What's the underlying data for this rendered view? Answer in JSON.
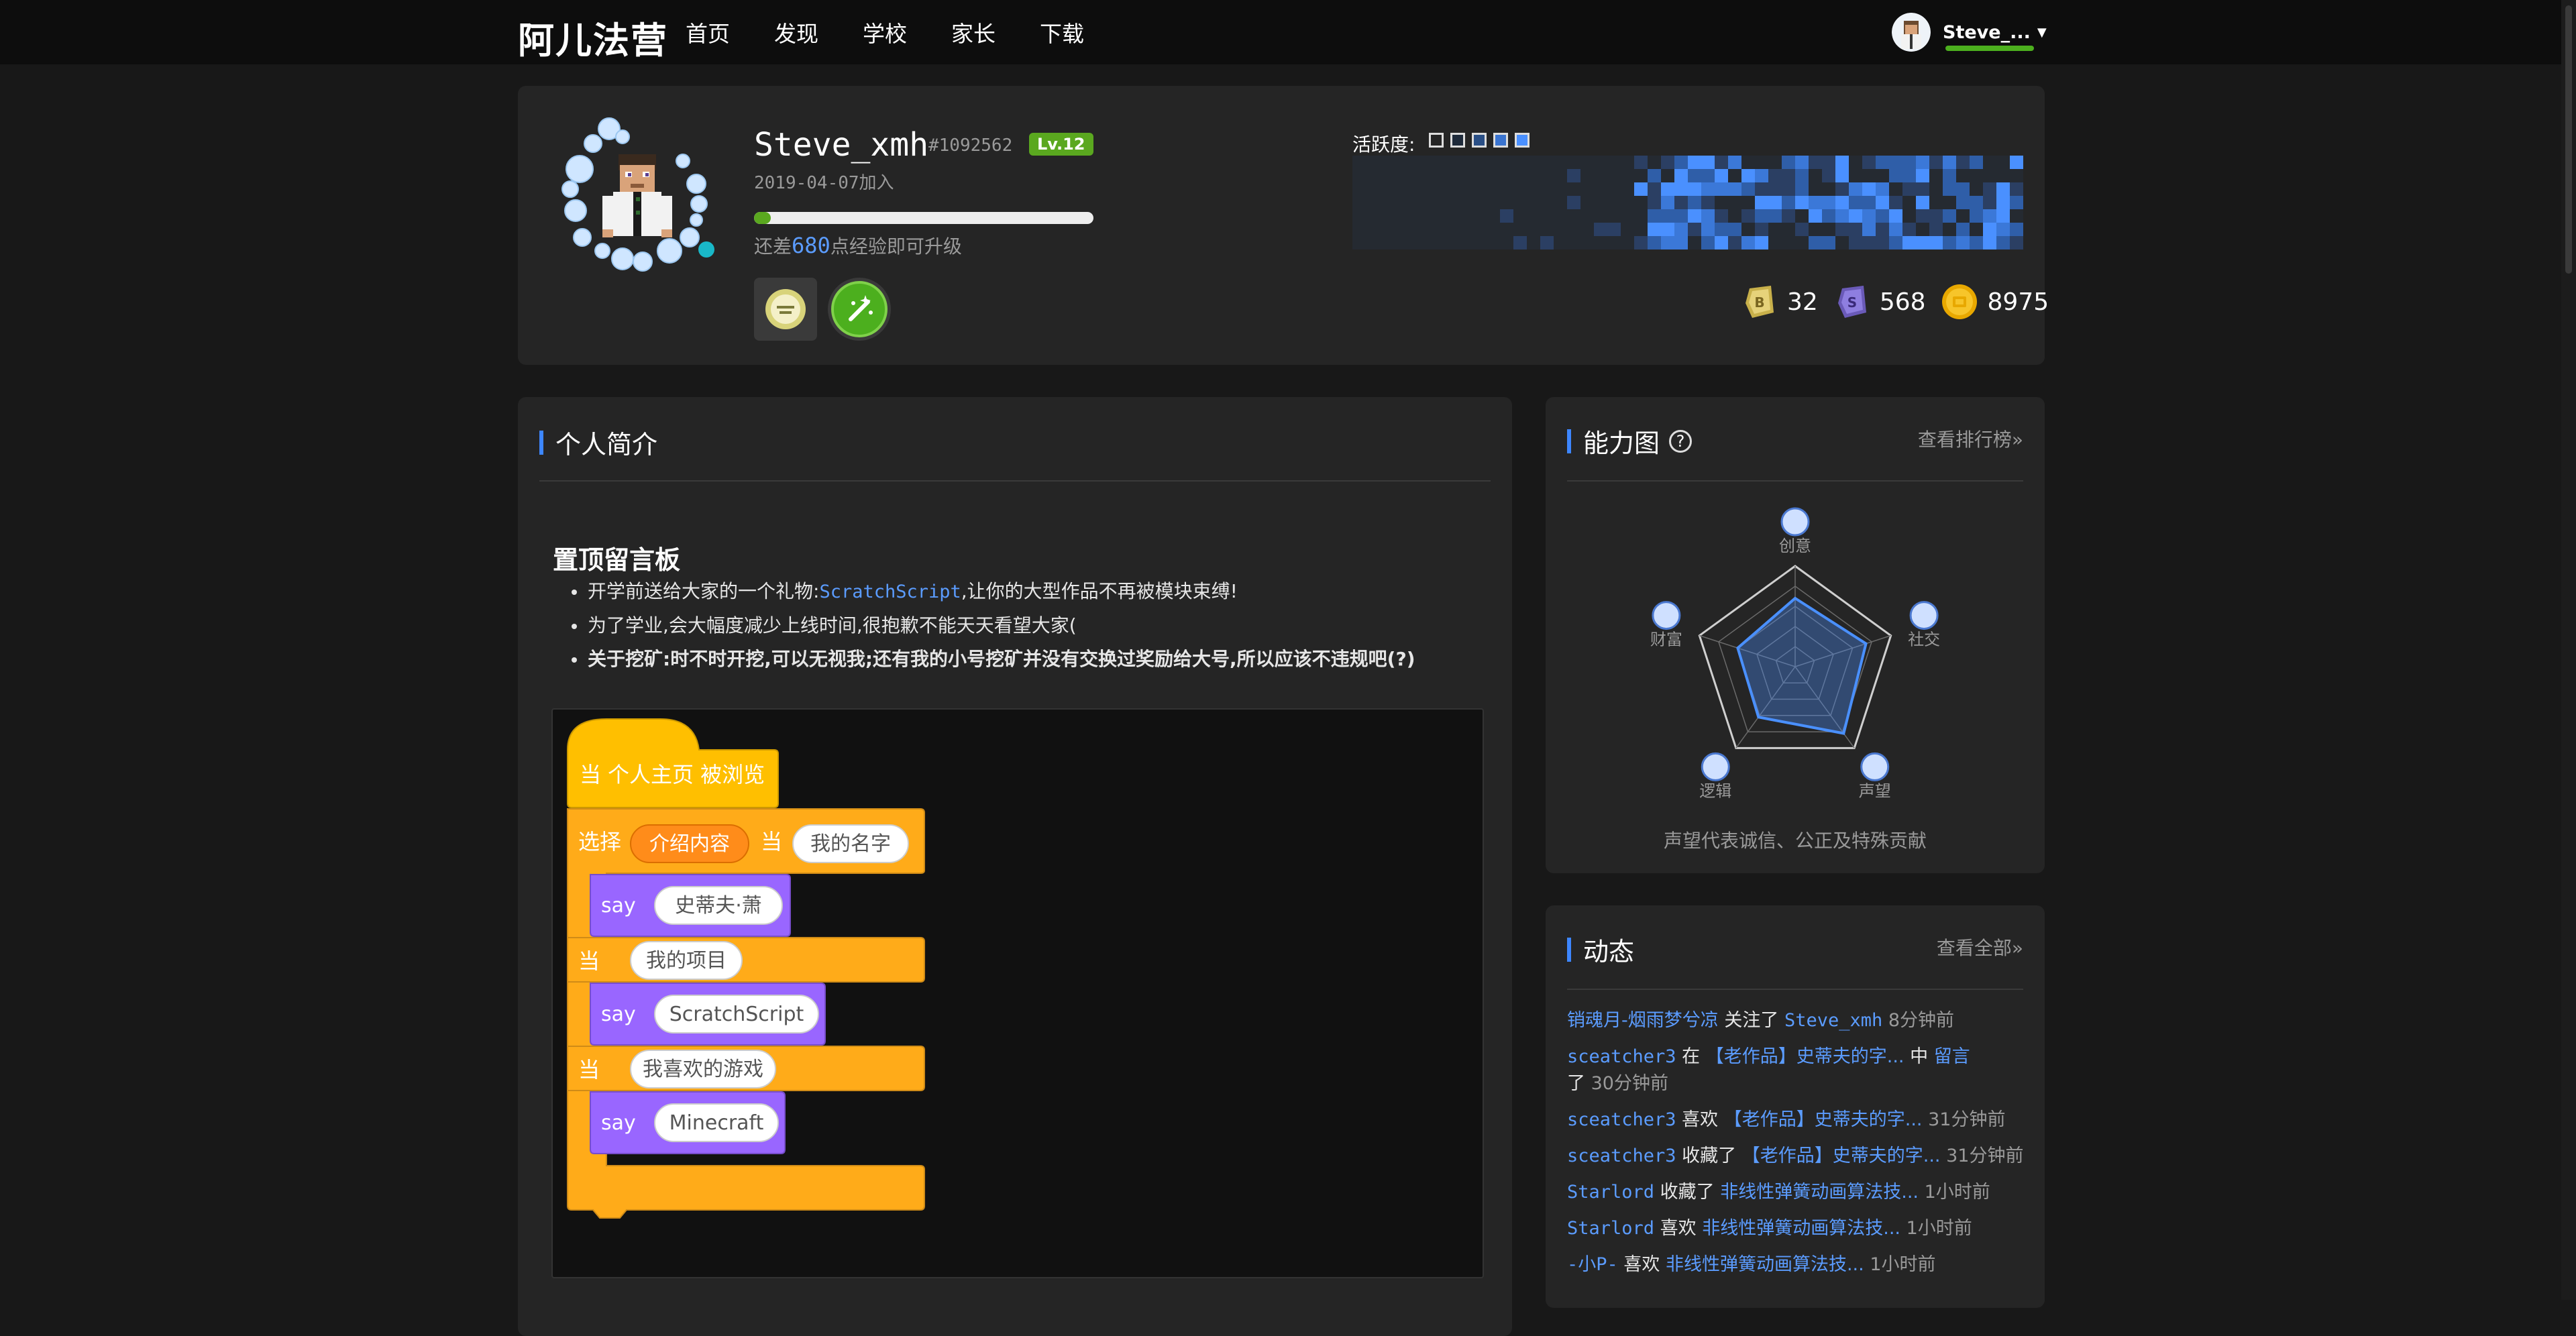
{
  "logo": "阿儿法营",
  "nav": [
    "首页",
    "发现",
    "学校",
    "家长",
    "下载"
  ],
  "user": {
    "name": "Steve_..."
  },
  "profile": {
    "name": "Steve_xmh",
    "id": "#1092562",
    "level": "Lv.12",
    "joined": "2019-04-07加入",
    "xp_progress": 0.05,
    "xp_prefix": "还差",
    "xp_needed": "680",
    "xp_suffix": "点经验即可升级",
    "activity_label": "活跃度:",
    "currency": [
      {
        "icon": "bronze-gem-icon",
        "value": "32"
      },
      {
        "icon": "purple-gem-icon",
        "value": "568"
      },
      {
        "icon": "gold-coin-icon",
        "value": "8975"
      }
    ]
  },
  "intro": {
    "title": "个人简介",
    "pinned_title": "置顶留言板",
    "bullet1_prefix": "开学前送给大家的一个礼物:",
    "bullet1_code": "ScratchScript",
    "bullet1_suffix": ",让你的大型作品不再被模块束缚!",
    "bullet2": "为了学业,会大幅度减少上线时间,很抱歉不能天天看望大家(",
    "bullet3": "关于挖矿:时不时开挖,可以无视我;还有我的小号挖矿并没有交换过奖励给大号,所以应该不违规吧(?)"
  },
  "scratch": {
    "hat_when": "当",
    "hat_text": "个人主页 被浏览",
    "switch": "选择",
    "switch_var": "介绍内容",
    "when": "当",
    "case1": "我的名字",
    "say": "say",
    "say1": "史蒂夫·萧",
    "case2": "我的项目",
    "say2": "ScratchScript",
    "case3": "我喜欢的游戏",
    "say3": "Minecraft"
  },
  "ability": {
    "title": "能力图",
    "more": "查看排行榜»",
    "axes": [
      "创意",
      "社交",
      "声望",
      "逻辑",
      "财富"
    ],
    "note": "声望代表诚信、公正及特殊贡献"
  },
  "feed": {
    "title": "动态",
    "more": "查看全部»",
    "items": [
      {
        "user": "销魂月-烟雨梦兮凉",
        "action": "关注了",
        "target": "Steve_xmh",
        "time": "8分钟前"
      },
      {
        "user": "sceatcher3",
        "action": "在",
        "target": "【老作品】史蒂夫的字...",
        "mid": "中",
        "target2": "留言",
        "end": "了",
        "time": "30分钟前"
      },
      {
        "user": "sceatcher3",
        "action": "喜欢",
        "target": "【老作品】史蒂夫的字...",
        "time": "31分钟前"
      },
      {
        "user": "sceatcher3",
        "action": "收藏了",
        "target": "【老作品】史蒂夫的字...",
        "time": "31分钟前"
      },
      {
        "user": "Starlord",
        "action": "收藏了",
        "target": "非线性弹簧动画算法技...",
        "time": "1小时前"
      },
      {
        "user": "Starlord",
        "action": "喜欢",
        "target": "非线性弹簧动画算法技...",
        "time": "1小时前"
      },
      {
        "user": "-小P-",
        "action": "喜欢",
        "target": "非线性弹簧动画算法技...",
        "time": "1小时前"
      }
    ]
  }
}
